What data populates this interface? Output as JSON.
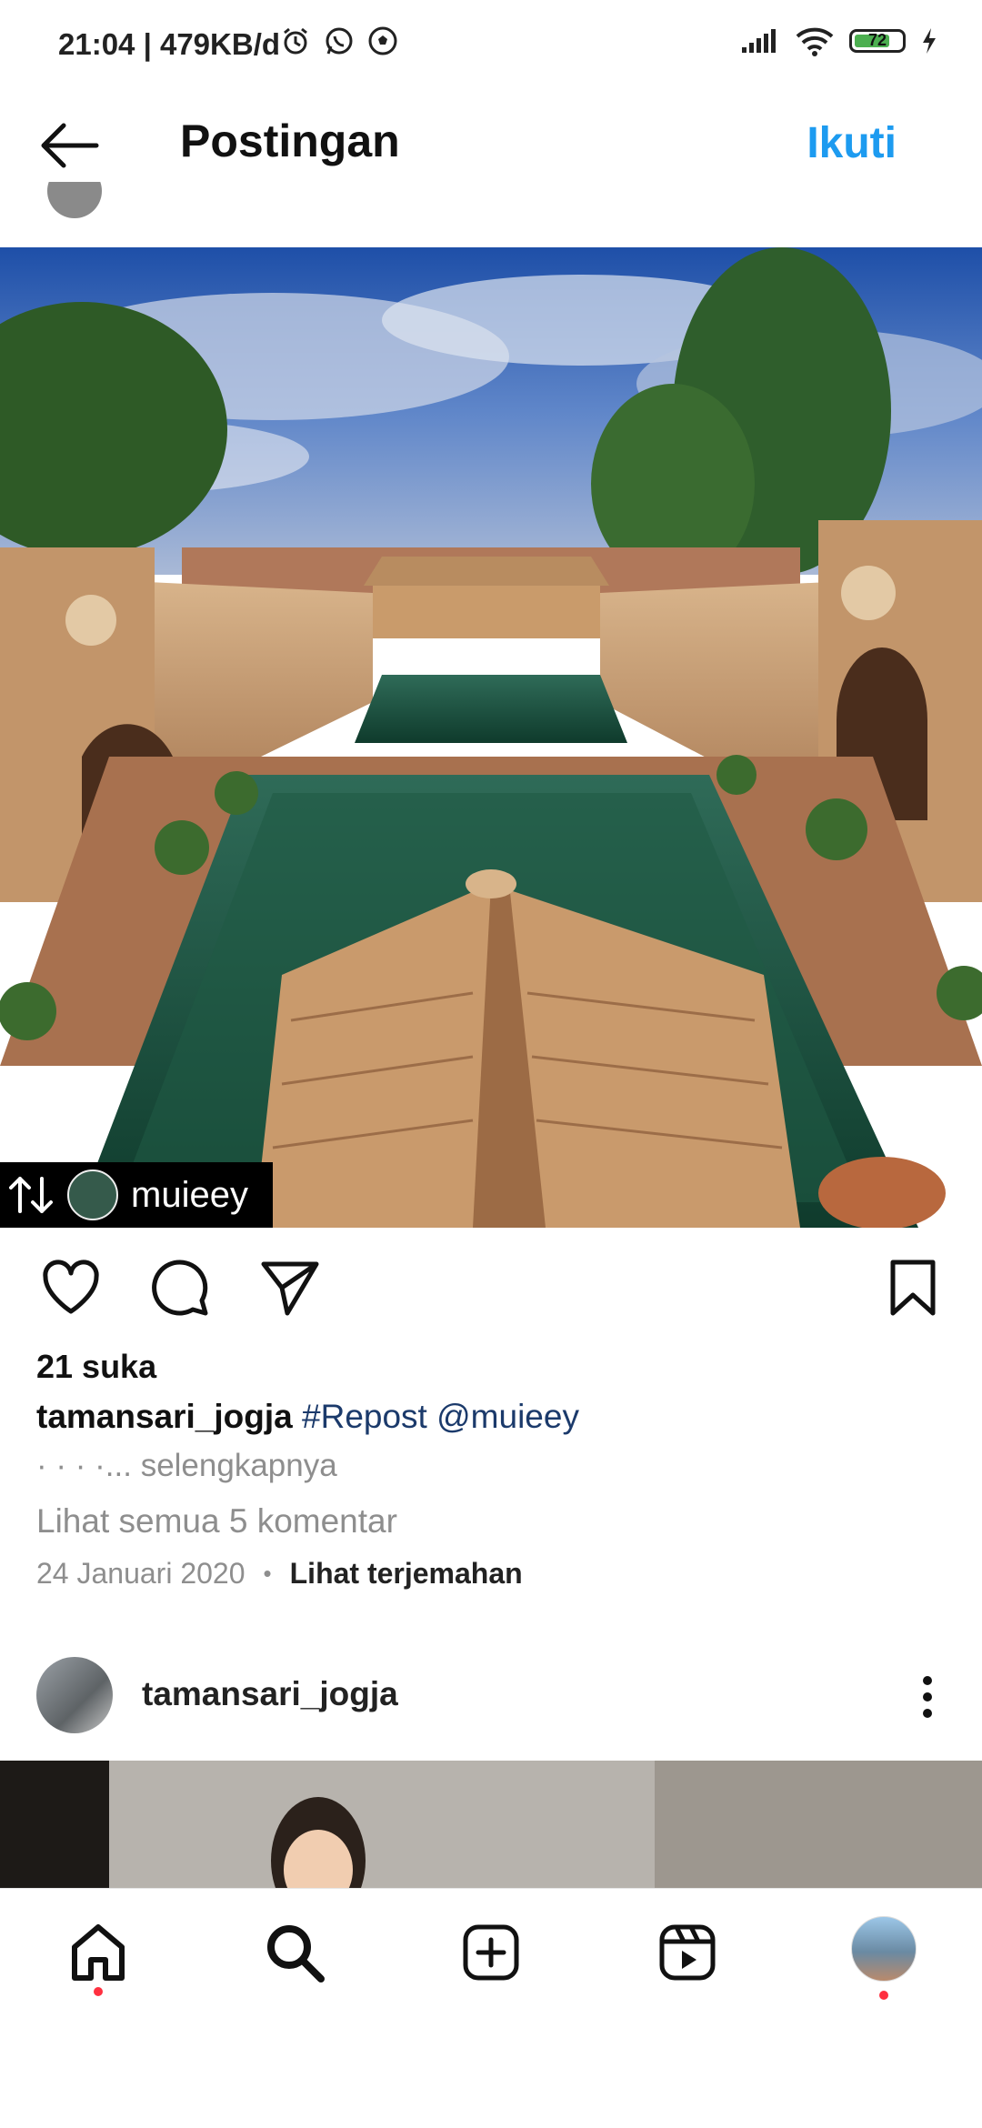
{
  "status_bar": {
    "time": "21:04 | 479KB/d",
    "battery_level": "72"
  },
  "header": {
    "title": "Postingan",
    "follow_label": "Ikuti"
  },
  "post": {
    "repost_username": "muieey",
    "likes": "21 suka",
    "caption_user": "tamansari_jogja",
    "caption_text": "#Repost @muieey",
    "more_text": "· · · ·... selengkapnya",
    "comments_link": "Lihat semua 5 komentar",
    "date": "24 Januari 2020",
    "translate_label": "Lihat terjemahan"
  },
  "next_post": {
    "username": "tamansari_jogja"
  },
  "colors": {
    "accent": "#1d9bf0",
    "hashtag": "#1b3a6b",
    "muted": "#8e8e8e",
    "notification_dot": "#ff3040"
  },
  "bottom_nav": {
    "items": [
      "home-icon",
      "search-icon",
      "create-icon",
      "reels-icon",
      "profile-avatar"
    ]
  }
}
